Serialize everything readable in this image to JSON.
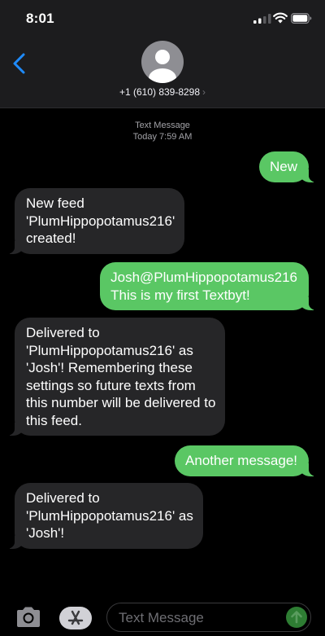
{
  "status_bar": {
    "time": "8:01"
  },
  "header": {
    "contact_number": "+1 (610) 839-8298"
  },
  "conversation": {
    "service_label": "Text Message",
    "timestamp": "Today 7:59 AM",
    "messages": [
      {
        "direction": "outgoing",
        "text": "New"
      },
      {
        "direction": "incoming",
        "text": "New feed\n'PlumHippopotamus216'\ncreated!"
      },
      {
        "direction": "outgoing",
        "text": "Josh@PlumHippopotamus216\nThis is my first Textbyt!"
      },
      {
        "direction": "incoming",
        "text": "Delivered to\n'PlumHippopotamus216' as\n'Josh'! Remembering these\nsettings so future texts from\nthis number will be delivered to\nthis feed."
      },
      {
        "direction": "outgoing",
        "text": "Another message!"
      },
      {
        "direction": "incoming",
        "text": "Delivered to\n'PlumHippopotamus216' as\n'Josh'!"
      }
    ]
  },
  "composer": {
    "placeholder": "Text Message"
  },
  "colors": {
    "outgoing_bubble": "#5ac764",
    "incoming_bubble": "#262628",
    "accent": "#1f8bff",
    "background": "#000000"
  },
  "icons": [
    "cellular-signal-icon",
    "wifi-icon",
    "battery-icon",
    "back-chevron-icon",
    "contact-avatar-icon",
    "camera-icon",
    "app-store-icon",
    "send-arrow-icon"
  ]
}
